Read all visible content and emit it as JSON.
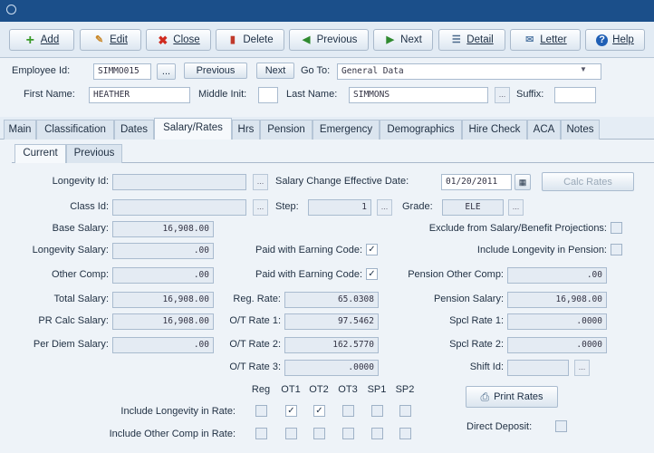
{
  "toolbar": {
    "add": "Add",
    "edit": "Edit",
    "close": "Close",
    "delete": "Delete",
    "previous": "Previous",
    "next": "Next",
    "detail": "Detail",
    "letter": "Letter",
    "help": "Help"
  },
  "header": {
    "employee_id_label": "Employee Id:",
    "employee_id": "SIMMO015",
    "ellipsis": "...",
    "prev_btn": "Previous",
    "next_btn": "Next",
    "goto_label": "Go To:",
    "goto_value": "General Data",
    "first_name_label": "First Name:",
    "first_name": "HEATHER",
    "middle_init_label": "Middle Init:",
    "middle_init": "",
    "last_name_label": "Last Name:",
    "last_name": "SIMMONS",
    "suffix_label": "Suffix:",
    "suffix": ""
  },
  "tabs": [
    "Main",
    "Classification",
    "Dates",
    "Salary/Rates",
    "Hrs",
    "Pension",
    "Emergency",
    "Demographics",
    "Hire Check",
    "ACA",
    "Notes"
  ],
  "subtabs": [
    "Current",
    "Previous"
  ],
  "form": {
    "longevity_id_label": "Longevity Id:",
    "longevity_id": "",
    "salary_change_label": "Salary Change Effective Date:",
    "salary_change_date": "01/20/2011",
    "calc_rates": "Calc Rates",
    "class_id_label": "Class Id:",
    "class_id": "",
    "step_label": "Step:",
    "step": "1",
    "grade_label": "Grade:",
    "grade": "ELE",
    "base_salary_label": "Base Salary:",
    "base_salary": "16,908.00",
    "exclude_label": "Exclude from Salary/Benefit Projections:",
    "longevity_salary_label": "Longevity Salary:",
    "longevity_salary": ".00",
    "paid_earning_label": "Paid with Earning Code:",
    "include_longevity_pension_label": "Include Longevity in Pension:",
    "other_comp_label": "Other Comp:",
    "other_comp": ".00",
    "paid_earning_label2": "Paid with Earning Code:",
    "pension_other_comp_label": "Pension Other Comp:",
    "pension_other_comp": ".00",
    "total_salary_label": "Total Salary:",
    "total_salary": "16,908.00",
    "reg_rate_label": "Reg. Rate:",
    "reg_rate": "65.0308",
    "pension_salary_label": "Pension Salary:",
    "pension_salary": "16,908.00",
    "pr_calc_label": "PR Calc Salary:",
    "pr_calc_salary": "16,908.00",
    "ot_rate1_label": "O/T Rate 1:",
    "ot_rate1": "97.5462",
    "spcl_rate1_label": "Spcl Rate 1:",
    "spcl_rate1": ".0000",
    "per_diem_label": "Per Diem Salary:",
    "per_diem_salary": ".00",
    "ot_rate2_label": "O/T Rate 2:",
    "ot_rate2": "162.5770",
    "spcl_rate2_label": "Spcl Rate 2:",
    "spcl_rate2": ".0000",
    "ot_rate3_label": "O/T Rate 3:",
    "ot_rate3": ".0000",
    "shift_id_label": "Shift Id:",
    "shift_id": ""
  },
  "rate_grid": {
    "headers": [
      "Reg",
      "OT1",
      "OT2",
      "OT3",
      "SP1",
      "SP2"
    ],
    "include_longevity_label": "Include Longevity in Rate:",
    "include_longevity_checked": [
      false,
      true,
      true,
      false,
      false,
      false
    ],
    "include_other_comp_label": "Include Other Comp in Rate:",
    "include_other_comp_checked": [
      false,
      false,
      false,
      false,
      false,
      false
    ],
    "print_rates": "Print Rates",
    "direct_deposit_label": "Direct Deposit:"
  },
  "checkboxes": {
    "exclude_projections": false,
    "paid_with_earning_code_1": true,
    "include_longevity_pension": false,
    "paid_with_earning_code_2": true,
    "direct_deposit": false
  },
  "colors": {
    "titlebar": "#1b4f8a",
    "accent_green": "#3a9a2a",
    "close_red": "#d02b20",
    "delete_red": "#c0392b",
    "help_blue": "#1f5fb5"
  },
  "icons": {
    "add": "plus-icon",
    "edit": "pencil-icon",
    "close": "x-icon",
    "delete": "trash-icon",
    "previous": "arrow-left-icon",
    "next": "arrow-right-icon",
    "detail": "list-icon",
    "letter": "envelope-icon",
    "help": "question-icon",
    "calendar": "calendar-icon",
    "printer": "printer-icon"
  }
}
